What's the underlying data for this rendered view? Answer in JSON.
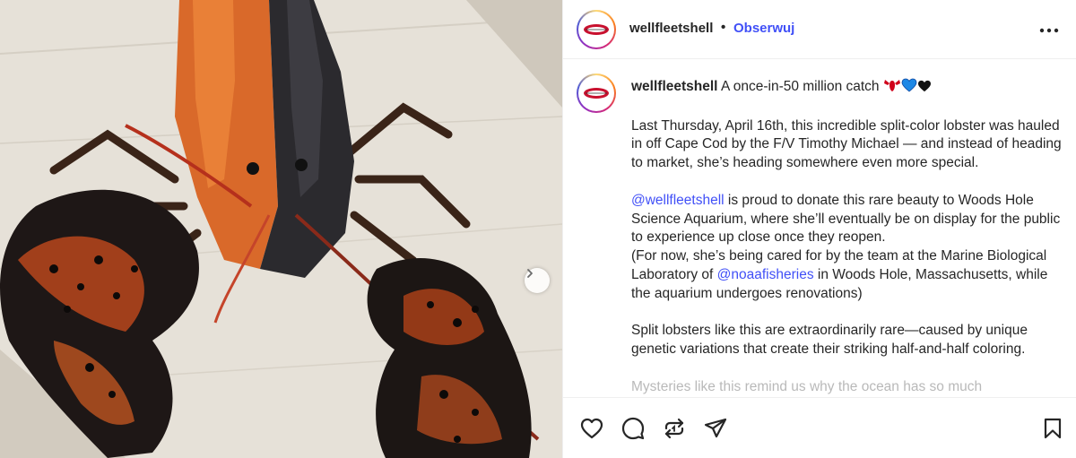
{
  "post": {
    "username": "wellfleetshell",
    "follow_label": "Obserwuj",
    "separator": "•",
    "more_label": "•••"
  },
  "caption": {
    "username": "wellfleetshell",
    "headline": "A once-in-50 million catch",
    "emojis": [
      "lobster-emoji",
      "blue-heart-emoji",
      "black-heart-emoji"
    ],
    "p1": "Last Thursday, April 16th, this incredible split-color lobster was hauled in off Cape Cod by the F/V Timothy Michael — and instead of heading to market, she’s heading somewhere even more special.",
    "p2_mention": "@wellfleetshell",
    "p2_rest": " is proud to donate this rare beauty to Woods Hole Science Aquarium, where she’ll eventually be on display for the public to experience up close once they reopen.",
    "p3_start": "(For now, she’s being cared for by the team at the Marine Biological Laboratory of ",
    "p3_mention": "@noaafisheries",
    "p3_end": " in Woods Hole, Massachusetts, while the aquarium undergoes renovations)",
    "p4": "Split lobsters like this are extraordinarily rare—caused by unique genetic variations that create their striking half-and-half coloring.",
    "p5_partial": "Mysteries like this remind us why the ocean has so much"
  },
  "actions": {
    "icons": [
      "heart-icon",
      "comment-icon",
      "repost-icon",
      "share-icon",
      "bookmark-icon"
    ]
  },
  "media": {
    "next_icon": "chevron-right-icon"
  },
  "colors": {
    "accent": "#4150f7",
    "text": "#262626",
    "border": "#efefef"
  }
}
